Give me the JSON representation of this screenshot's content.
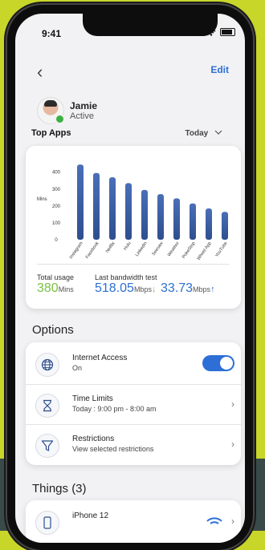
{
  "status_bar": {
    "time": "9:41"
  },
  "header": {
    "edit_label": "Edit"
  },
  "user": {
    "name": "Jamie",
    "status": "Active"
  },
  "top_apps": {
    "title": "Top Apps",
    "period": "Today"
  },
  "chart_data": {
    "type": "bar",
    "categories": [
      "Instagram",
      "Facebook",
      "Netflix",
      "Hulu",
      "LinkedIn",
      "Seesaw",
      "Weather",
      "PokeStop",
      "Wheel App",
      "YouTube"
    ],
    "values": [
      445,
      395,
      370,
      335,
      295,
      270,
      245,
      215,
      185,
      165
    ],
    "ylabel": "Mins",
    "yticks": [
      0,
      100,
      200,
      300,
      400
    ],
    "ylim": [
      0,
      470
    ],
    "grid": false,
    "bar_color": "#2e4f8e"
  },
  "usage": {
    "total_label": "Total usage",
    "total_value": "380",
    "total_unit": "Mins",
    "bandwidth_label": "Last bandwidth test",
    "download_value": "518.05",
    "download_unit": "Mbps",
    "upload_value": "33.73",
    "upload_unit": "Mbps"
  },
  "options": {
    "title": "Options",
    "items": [
      {
        "title": "Internet Access",
        "subtitle": "On",
        "icon": "globe-icon",
        "control": "toggle",
        "enabled": true
      },
      {
        "title": "Time Limits",
        "subtitle": "Today : 9:00 pm - 8:00 am",
        "icon": "hourglass-icon",
        "control": "chevron"
      },
      {
        "title": "Restrictions",
        "subtitle": "View selected restrictions",
        "icon": "filter-icon",
        "control": "chevron"
      }
    ]
  },
  "things": {
    "title": "Things (3)",
    "items": [
      {
        "title": "iPhone 12",
        "icon": "phone-icon"
      }
    ]
  },
  "colors": {
    "accent": "#2d6fd6",
    "green": "#7ac143",
    "background": "#c8d62a"
  }
}
